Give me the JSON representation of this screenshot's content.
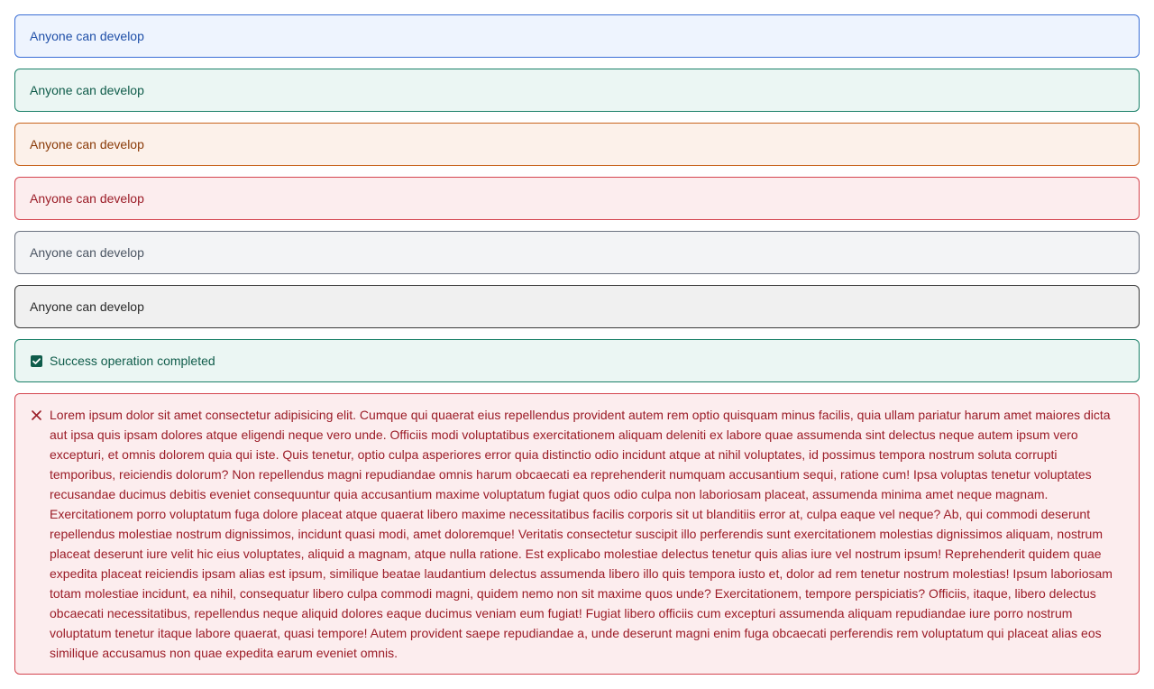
{
  "alerts": [
    {
      "variant": "blue",
      "text": "Anyone can develop"
    },
    {
      "variant": "green",
      "text": "Anyone can develop"
    },
    {
      "variant": "orange",
      "text": "Anyone can develop"
    },
    {
      "variant": "red",
      "text": "Anyone can develop"
    },
    {
      "variant": "gray",
      "text": "Anyone can develop"
    },
    {
      "variant": "dark",
      "text": "Anyone can develop"
    }
  ],
  "success": {
    "icon": "check-square-icon",
    "text": "Success operation completed"
  },
  "error": {
    "icon": "close-icon",
    "text": "Lorem ipsum dolor sit amet consectetur adipisicing elit. Cumque qui quaerat eius repellendus provident autem rem optio quisquam minus facilis, quia ullam pariatur harum amet maiores dicta aut ipsa quis ipsam dolores atque eligendi neque vero unde. Officiis modi voluptatibus exercitationem aliquam deleniti ex labore quae assumenda sint delectus neque autem ipsum vero excepturi, et omnis dolorem quia qui iste. Quis tenetur, optio culpa asperiores error quia distinctio odio incidunt atque at nihil voluptates, id possimus tempora nostrum soluta corrupti temporibus, reiciendis dolorum? Non repellendus magni repudiandae omnis harum obcaecati ea reprehenderit numquam accusantium sequi, ratione cum! Ipsa voluptas tenetur voluptates recusandae ducimus debitis eveniet consequuntur quia accusantium maxime voluptatum fugiat quos odio culpa non laboriosam placeat, assumenda minima amet neque magnam. Exercitationem porro voluptatum fuga dolore placeat atque quaerat libero maxime necessitatibus facilis corporis sit ut blanditiis error at, culpa eaque vel neque? Ab, qui commodi deserunt repellendus molestiae nostrum dignissimos, incidunt quasi modi, amet doloremque! Veritatis consectetur suscipit illo perferendis sunt exercitationem molestias dignissimos aliquam, nostrum placeat deserunt iure velit hic eius voluptates, aliquid a magnam, atque nulla ratione. Est explicabo molestiae delectus tenetur quis alias iure vel nostrum ipsum! Reprehenderit quidem quae expedita placeat reiciendis ipsam alias est ipsum, similique beatae laudantium delectus assumenda libero illo quis tempora iusto et, dolor ad rem tenetur nostrum molestias! Ipsum laboriosam totam molestiae incidunt, ea nihil, consequatur libero culpa commodi magni, quidem nemo non sit maxime quos unde? Exercitationem, tempore perspiciatis? Officiis, itaque, libero delectus obcaecati necessitatibus, repellendus neque aliquid dolores eaque ducimus veniam eum fugiat! Fugiat libero officiis cum excepturi assumenda aliquam repudiandae iure porro nostrum voluptatum tenetur itaque labore quaerat, quasi tempore! Autem provident saepe repudiandae a, unde deserunt magni enim fuga obcaecati perferendis rem voluptatum qui placeat alias eos similique accusamus non quae expedita earum eveniet omnis."
  }
}
